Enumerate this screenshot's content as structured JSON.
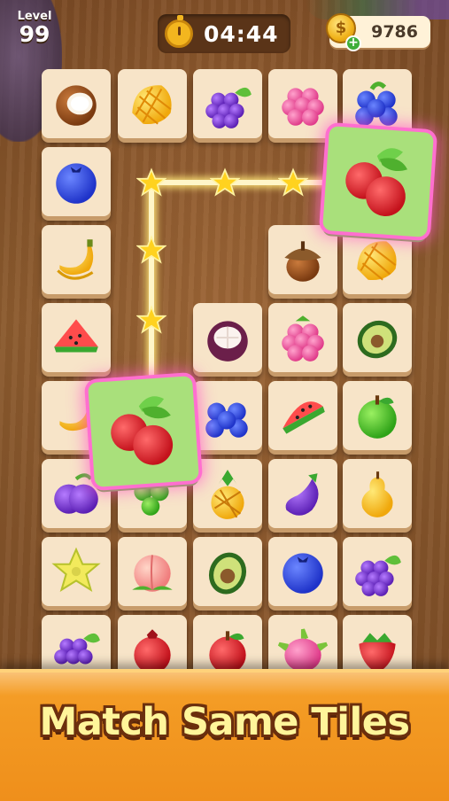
{
  "hud": {
    "level_label": "Level",
    "level_number": "99",
    "timer": "04:44",
    "coins": "9786",
    "coin_symbol": "$",
    "add_symbol": "+"
  },
  "board": {
    "tiles": [
      {
        "fruit": "coconut"
      },
      {
        "fruit": "mango"
      },
      {
        "fruit": "grapes"
      },
      {
        "fruit": "raspberry"
      },
      {
        "fruit": "blueberries"
      },
      {
        "fruit": "blueberry"
      },
      {
        "fruit": "cranberry-selected"
      },
      {
        "fruit": "banana"
      },
      {
        "fruit": "acorn"
      },
      {
        "fruit": "mango"
      },
      {
        "fruit": "watermelon"
      },
      {
        "fruit": "mangosteen"
      },
      {
        "fruit": "raspberry"
      },
      {
        "fruit": "avocado"
      },
      {
        "fruit": "banana"
      },
      {
        "fruit": "cranberry-selected"
      },
      {
        "fruit": "blueberries"
      },
      {
        "fruit": "watermelon"
      },
      {
        "fruit": "green-apple"
      },
      {
        "fruit": "plum"
      },
      {
        "fruit": "green-grapes"
      },
      {
        "fruit": "pineapple"
      },
      {
        "fruit": "eggplant"
      },
      {
        "fruit": "pear"
      },
      {
        "fruit": "star-fruit"
      },
      {
        "fruit": "peach"
      },
      {
        "fruit": "avocado"
      },
      {
        "fruit": "blueberry"
      },
      {
        "fruit": "grapes"
      },
      {
        "fruit": "grapes"
      },
      {
        "fruit": "pomegranate"
      },
      {
        "fruit": "red-apple"
      },
      {
        "fruit": "dragon-fruit"
      },
      {
        "fruit": "strawberry"
      }
    ],
    "matched_pair": "cranberry",
    "path_stars": 5
  },
  "banner": {
    "text": "Match Same Tiles"
  },
  "colors": {
    "tile_face": "#f7e4c8",
    "selected_tile": "#a9e07b",
    "selection_glow": "#ff6fcf",
    "banner_orange": "#f39a23",
    "banner_text": "#fff59a"
  }
}
